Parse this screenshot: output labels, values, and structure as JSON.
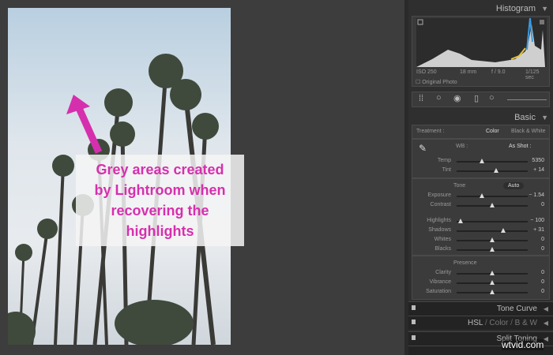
{
  "annotation": {
    "lines": [
      "Grey areas created",
      "by Lightroom when",
      "recovering the",
      "highlights"
    ],
    "color": "#d62fae"
  },
  "histogram": {
    "title": "Histogram",
    "iso": "ISO 250",
    "focal": "18 mm",
    "aperture": "f / 9.0",
    "shutter": "1/125 sec",
    "original_photo": "Original Photo"
  },
  "tools": [
    "crop-overlay",
    "spot-removal",
    "red-eye",
    "graduated-filter",
    "radial-filter",
    "adjustment-brush"
  ],
  "basic": {
    "title": "Basic",
    "treatment_label": "Treatment :",
    "color": "Color",
    "bw": "Black & White",
    "wb_label": "WB :",
    "wb_value": "As Shot :",
    "wb_sliders": [
      {
        "label": "Temp",
        "value": "5350",
        "pos": 0.36
      },
      {
        "label": "Tint",
        "value": "+ 14",
        "pos": 0.55
      }
    ],
    "tone_label": "Tone",
    "auto": "Auto",
    "tone_sliders": [
      {
        "label": "Exposure",
        "value": "− 1.54",
        "pos": 0.36
      },
      {
        "label": "Contrast",
        "value": "0",
        "pos": 0.5
      },
      {
        "label": "Highlights",
        "value": "− 100",
        "pos": 0.05
      },
      {
        "label": "Shadows",
        "value": "+ 31",
        "pos": 0.65
      },
      {
        "label": "Whites",
        "value": "0",
        "pos": 0.5
      },
      {
        "label": "Blacks",
        "value": "0",
        "pos": 0.5
      }
    ],
    "presence_label": "Presence",
    "presence_sliders": [
      {
        "label": "Clarity",
        "value": "0",
        "pos": 0.5
      },
      {
        "label": "Vibrance",
        "value": "0",
        "pos": 0.5
      },
      {
        "label": "Saturation",
        "value": "0",
        "pos": 0.5
      }
    ]
  },
  "panels": {
    "tone_curve": "Tone Curve",
    "hsl": "HSL",
    "hsl_color": "Color",
    "hsl_bw": "B & W",
    "sep": "/",
    "split_toning": "Split Toning"
  },
  "watermark": "wtvid.com"
}
